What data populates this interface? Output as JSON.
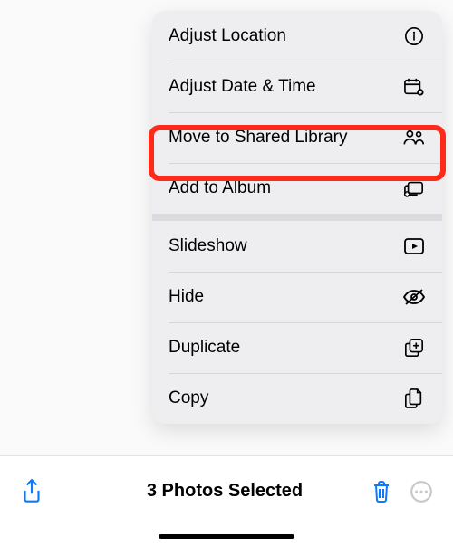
{
  "menu": {
    "group1": [
      {
        "label": "Adjust Location",
        "icon": "info-pin-icon"
      },
      {
        "label": "Adjust Date & Time",
        "icon": "calendar-badge-icon"
      },
      {
        "label": "Move to Shared Library",
        "icon": "two-people-icon",
        "highlighted": true
      },
      {
        "label": "Add to Album",
        "icon": "album-add-icon"
      }
    ],
    "group2": [
      {
        "label": "Slideshow",
        "icon": "play-rect-icon"
      },
      {
        "label": "Hide",
        "icon": "eye-slash-icon"
      },
      {
        "label": "Duplicate",
        "icon": "square-plus-icon"
      },
      {
        "label": "Copy",
        "icon": "doc-on-doc-icon"
      }
    ]
  },
  "toolbar": {
    "title": "3 Photos Selected",
    "share_icon": "share-icon",
    "trash_icon": "trash-icon",
    "more_icon": "ellipsis-circle-icon"
  },
  "colors": {
    "accent_blue": "#0a7aff",
    "highlight_red": "#ff2a1a",
    "disabled_gray": "#c7c7cc"
  }
}
